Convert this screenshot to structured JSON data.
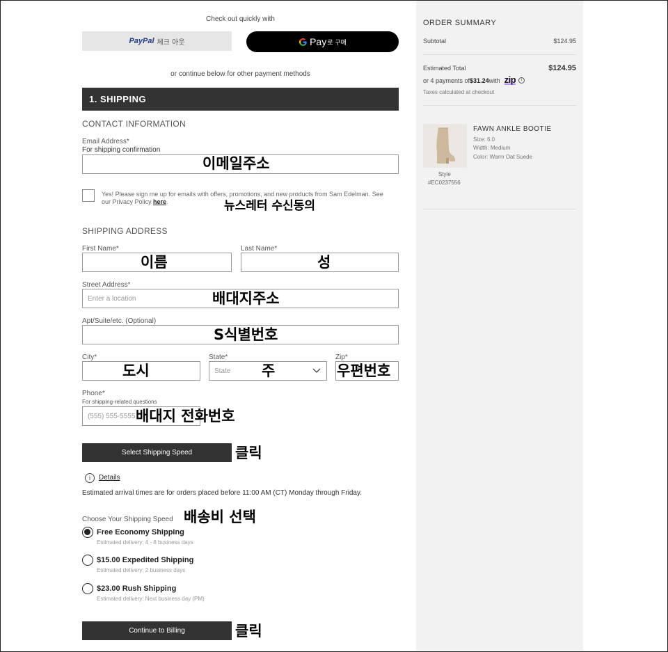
{
  "express": {
    "heading": "Check out quickly with",
    "paypal_brand": "PayPal",
    "paypal_suffix": "체크 아웃",
    "gpay_brand": "Pay",
    "gpay_suffix": "로 구매",
    "or_continue": "or continue below for other payment methods"
  },
  "shipping": {
    "section_title": "1. SHIPPING",
    "contact_heading": "CONTACT INFORMATION",
    "email_label": "Email Address*",
    "email_sublabel": "For shipping confirmation",
    "newsletter_text": "Yes! Please sign me up for emails with offers, promotions, and new products from Sam Edelman. See our Privacy Policy ",
    "newsletter_link": "here",
    "address_heading": "SHIPPING ADDRESS",
    "first_name_label": "First Name*",
    "last_name_label": "Last Name*",
    "street_label": "Street Address*",
    "street_placeholder": "Enter a location",
    "apt_label": "Apt/Suite/etc. (Optional)",
    "city_label": "City*",
    "state_label": "State*",
    "state_value": "State",
    "zip_label": "Zip*",
    "phone_label": "Phone*",
    "phone_sublabel": "For shipping-related questions",
    "phone_placeholder": "(555) 555-5555",
    "select_speed_button": "Select Shipping Speed",
    "details_link": "Details",
    "arrival_note": "Estimated arrival times are for orders placed before 11:00 AM (CT) Monday through Friday.",
    "speed_heading": "Choose Your Shipping Speed",
    "options": [
      {
        "name": "Free Economy Shipping",
        "sub": "Estimated delivery: 4 - 8 business days",
        "selected": true
      },
      {
        "name": "$15.00 Expedited Shipping",
        "sub": "Estimated delivery: 2 business days",
        "selected": false
      },
      {
        "name": "$23.00 Rush Shipping",
        "sub": "Estimated delivery: Next business day (PM)",
        "selected": false
      }
    ],
    "continue_button": "Continue to Billing"
  },
  "annotations": {
    "email": "이메일주소",
    "newsletter": "뉴스레터 수신동의",
    "first_name": "이름",
    "last_name": "성",
    "street": "배대지주소",
    "apt": "S식별번호",
    "city": "도시",
    "state": "주",
    "zip": "우편번호",
    "phone": "배대지 전화번호",
    "click1": "클릭",
    "speed": "배송비 선택",
    "click2": "클릭"
  },
  "summary": {
    "title": "ORDER SUMMARY",
    "subtotal_label": "Subtotal",
    "subtotal_value": "$124.95",
    "est_total_label": "Estimated Total",
    "est_total_value": "$124.95",
    "installments_prefix": "or 4 payments of ",
    "installments_amount": "$31.24",
    "installments_suffix": " with",
    "zip_brand": "zip",
    "taxes_note": "Taxes calculated at checkout",
    "product": {
      "name": "FAWN ANKLE BOOTIE",
      "size": "Size: 6.0",
      "width": "Width: Medium",
      "color": "Color: Warm Oat Suede",
      "style_label": "Style",
      "style_code": "#EC0237556"
    }
  },
  "colors": {
    "dark": "#333333",
    "sidebar_bg": "#f2f2f2",
    "paypal_blue": "#253b80",
    "paypal_light": "#179bd7"
  }
}
